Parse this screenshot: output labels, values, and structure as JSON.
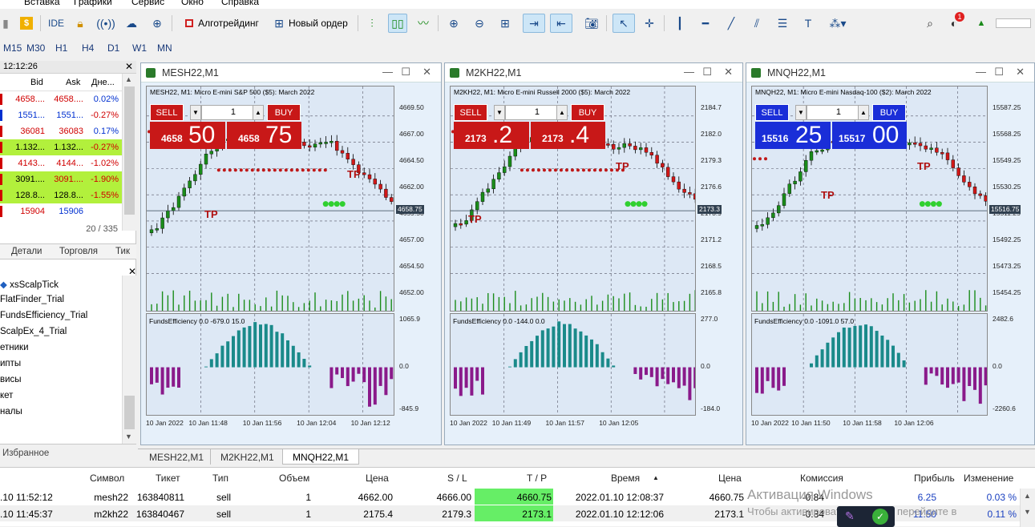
{
  "menu": {
    "items": [
      "Вставка",
      "Графики",
      "Сервис",
      "Окно",
      "Справка"
    ]
  },
  "toolbar": {
    "ide_label": "IDE",
    "algo_label": "Алготрейдинг",
    "order_label": "Новый ордер",
    "badge": "1"
  },
  "timeframes": [
    "M15",
    "M30",
    "H1",
    "H4",
    "D1",
    "W1",
    "MN"
  ],
  "market_watch": {
    "time": "12:12:26",
    "columns": [
      "Bid",
      "Ask",
      "Дне..."
    ],
    "rows": [
      {
        "bid": "4658....",
        "ask": "4658....",
        "chg": "0.02%",
        "bid_color": "#d00000",
        "ask_color": "#d00000",
        "chg_color": "#0030d0",
        "bg": "#ffffff"
      },
      {
        "bid": "1551...",
        "ask": "1551...",
        "chg": "-0.27%",
        "bid_color": "#0030d0",
        "ask_color": "#0030d0",
        "chg_color": "#d00000",
        "bg": "#ffffff"
      },
      {
        "bid": "36081",
        "ask": "36083",
        "chg": "0.17%",
        "bid_color": "#d00000",
        "ask_color": "#d00000",
        "chg_color": "#0030d0",
        "bg": "#ffffff"
      },
      {
        "bid": "1.132...",
        "ask": "1.132...",
        "chg": "-0.27%",
        "bid_color": "#000000",
        "ask_color": "#000000",
        "chg_color": "#d00000",
        "bg": "#b2f03c"
      },
      {
        "bid": "4143...",
        "ask": "4144...",
        "chg": "-1.02%",
        "bid_color": "#d00000",
        "ask_color": "#d00000",
        "chg_color": "#d00000",
        "bg": "#ffffff"
      },
      {
        "bid": "3091....",
        "ask": "3091....",
        "chg": "-1.90%",
        "bid_color": "#000000",
        "ask_color": "#d00000",
        "chg_color": "#d00000",
        "bg": "#b2f03c"
      },
      {
        "bid": "128.8...",
        "ask": "128.8...",
        "chg": "-1.55%",
        "bid_color": "#000000",
        "ask_color": "#000000",
        "chg_color": "#d00000",
        "bg": "#b2f03c"
      },
      {
        "bid": "15904",
        "ask": "15906",
        "chg": "",
        "bid_color": "#d00000",
        "ask_color": "#0030d0",
        "chg_color": "#000000",
        "bg": "#ffffff"
      }
    ],
    "count": "20 / 335",
    "tabs": [
      "Детали",
      "Торговля",
      "Тик"
    ]
  },
  "navigator": {
    "items": [
      "xsScalpTick",
      "FlatFinder_Trial",
      "FundsEfficiency_Trial",
      "ScalpEx_4_Trial",
      "етники",
      "ипты",
      "висы",
      "кет",
      "налы"
    ],
    "bottom_tab": "Избранное"
  },
  "charts": [
    {
      "window_title": "MESH22,M1",
      "plot_title": "MESH22, M1:  Micro E-mini S&P 500 ($5): March 2022",
      "sell_label": "SELL",
      "buy_label": "BUY",
      "lot": "1",
      "sell_small": "4658",
      "sell_big": "50",
      "buy_small": "4658",
      "buy_big": "75",
      "panel_color": "#c81818",
      "price_labels": [
        "4669.50",
        "4667.00",
        "4664.50",
        "4662.00",
        "4659.50",
        "4657.00",
        "4654.50",
        "4652.00"
      ],
      "current_price": "4658.75",
      "ind_title": "FundsEfficiency 0.0 -679.0 15.0",
      "ind_labels": [
        "1065.9",
        "0.0",
        "-845.9"
      ],
      "time_labels": [
        "10 Jan 2022",
        "10 Jan 11:48",
        "10 Jan 11:56",
        "10 Jan 12:04",
        "10 Jan 12:12"
      ]
    },
    {
      "window_title": "M2KH22,M1",
      "plot_title": "M2KH22, M1:  Micro E-mini Russell 2000 ($5): March 2022",
      "sell_label": "SELL",
      "buy_label": "BUY",
      "lot": "1",
      "sell_small": "2173",
      "sell_big": ".2",
      "buy_small": "2173",
      "buy_big": ".4",
      "panel_color": "#c81818",
      "price_labels": [
        "2184.7",
        "2182.0",
        "2179.3",
        "2176.6",
        "2173.9",
        "2171.2",
        "2168.5",
        "2165.8"
      ],
      "current_price": "2173.3",
      "ind_title": "FundsEfficiency 0.0 -144.0 0.0",
      "ind_labels": [
        "277.0",
        "0.0",
        "-184.0"
      ],
      "time_labels": [
        "10 Jan 2022",
        "10 Jan 11:49",
        "10 Jan 11:57",
        "10 Jan 12:05"
      ]
    },
    {
      "window_title": "MNQH22,M1",
      "plot_title": "MNQH22, M1:  Micro E-mini Nasdaq-100 ($2): March 2022",
      "sell_label": "SELL",
      "buy_label": "BUY",
      "lot": "1",
      "sell_small": "15516",
      "sell_big": "25",
      "buy_small": "15517",
      "buy_big": "00",
      "panel_color": "#1a2ed8",
      "price_labels": [
        "15587.25",
        "15568.25",
        "15549.25",
        "15530.25",
        "15511.25",
        "15492.25",
        "15473.25",
        "15454.25"
      ],
      "current_price": "15516.75",
      "ind_title": "FundsEfficiency 0.0 -1091.0 57.0",
      "ind_labels": [
        "2482.6",
        "0.0",
        "-2260.6"
      ],
      "time_labels": [
        "10 Jan 2022",
        "10 Jan 11:50",
        "10 Jan 11:58",
        "10 Jan 12:06"
      ]
    }
  ],
  "tp_label": "TP",
  "chart_tabs": [
    "MESH22,M1",
    "M2KH22,M1",
    "MNQH22,M1"
  ],
  "terminal": {
    "columns": [
      "Символ",
      "Тикет",
      "Тип",
      "Объем",
      "Цена",
      "S / L",
      "T / P",
      "Время",
      "Цена",
      "Комиссия",
      "Прибыль",
      "Изменение"
    ],
    "rows": [
      {
        "time_open": ".10 11:52:12",
        "symbol": "mesh22",
        "ticket": "163840811",
        "type": "sell",
        "volume": "1",
        "price": "4662.00",
        "sl": "4666.00",
        "tp": "4660.75",
        "time": "2022.01.10 12:08:37",
        "cur": "4660.75",
        "comm": "-0.84",
        "profit": "6.25",
        "change": "0.03 %"
      },
      {
        "time_open": ".10 11:45:37",
        "symbol": "m2kh22",
        "ticket": "163840467",
        "type": "sell",
        "volume": "1",
        "price": "2175.4",
        "sl": "2179.3",
        "tp": "2173.1",
        "time": "2022.01.10 12:12:06",
        "cur": "2173.1",
        "comm": "-0.84",
        "profit": "11.50",
        "change": "0.11 %"
      }
    ]
  },
  "watermark": {
    "line1": "Активация Windows",
    "line2": "Чтобы активировать Windows, перейдите в"
  },
  "colors": {
    "bull": "#1a8c1a",
    "bear": "#d01818",
    "volume": "#1a8c1a",
    "ind_pos": "#1a8a8a",
    "ind_neg": "#8a1a8a",
    "tp_bg": "#66ee66"
  }
}
